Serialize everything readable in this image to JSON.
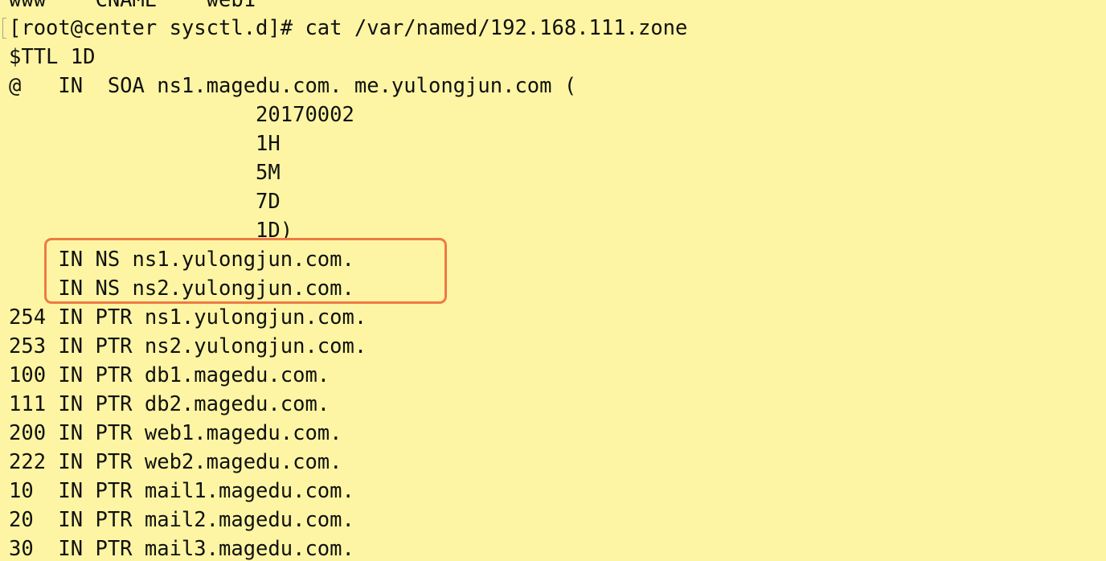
{
  "terminal": {
    "cut_top_line": "www    CNAME    web1",
    "lines": [
      "[root@center sysctl.d]# cat /var/named/192.168.111.zone",
      "$TTL 1D",
      "@   IN  SOA ns1.magedu.com. me.yulongjun.com (",
      "                    20170002",
      "                    1H",
      "                    5M",
      "                    7D",
      "                    1D)",
      "    IN NS ns1.yulongjun.com.",
      "    IN NS ns2.yulongjun.com.",
      "254 IN PTR ns1.yulongjun.com.",
      "253 IN PTR ns2.yulongjun.com.",
      "100 IN PTR db1.magedu.com.",
      "111 IN PTR db2.magedu.com.",
      "200 IN PTR web1.magedu.com.",
      "222 IN PTR web2.magedu.com.",
      "10  IN PTR mail1.magedu.com.",
      "20  IN PTR mail2.magedu.com.",
      "30  IN PTR mail3.magedu.com."
    ]
  },
  "colors": {
    "background": "#fdf5a3",
    "text": "#111111",
    "highlight_border": "#ee7a45"
  }
}
